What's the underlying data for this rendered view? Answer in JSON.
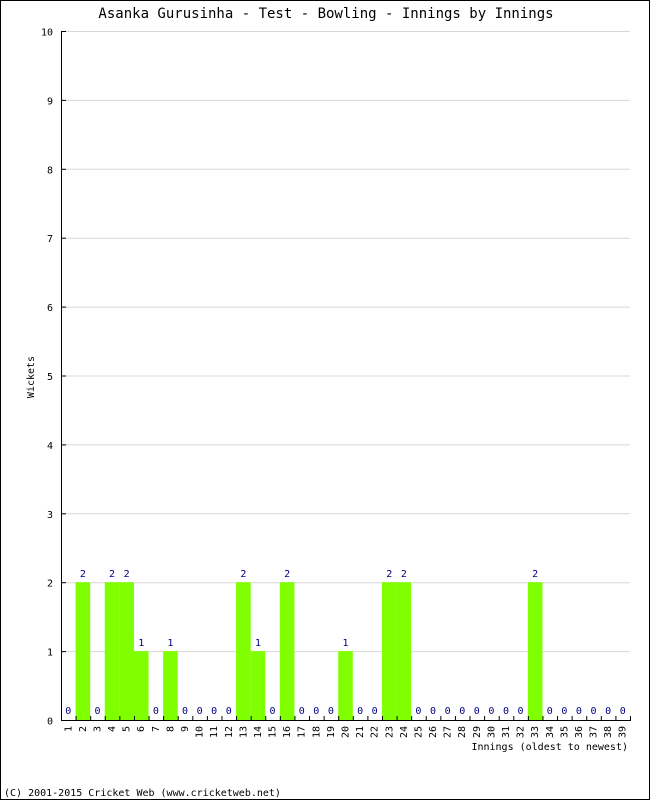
{
  "chart_data": {
    "type": "bar",
    "title": "Asanka Gurusinha - Test - Bowling - Innings by Innings",
    "xlabel": "Innings (oldest to newest)",
    "ylabel": "Wickets",
    "ylim": [
      0,
      10
    ],
    "yticks": [
      0,
      1,
      2,
      3,
      4,
      5,
      6,
      7,
      8,
      9,
      10
    ],
    "grid": true,
    "bar_color": "#80ff00",
    "label_color": "#000080",
    "categories": [
      "1",
      "2",
      "3",
      "4",
      "5",
      "6",
      "7",
      "8",
      "9",
      "10",
      "11",
      "12",
      "13",
      "14",
      "15",
      "16",
      "17",
      "18",
      "19",
      "20",
      "21",
      "22",
      "23",
      "24",
      "25",
      "26",
      "27",
      "28",
      "29",
      "30",
      "31",
      "32",
      "33",
      "34",
      "35",
      "36",
      "37",
      "38",
      "39"
    ],
    "values": [
      0,
      2,
      0,
      2,
      2,
      1,
      0,
      1,
      0,
      0,
      0,
      0,
      2,
      1,
      0,
      2,
      0,
      0,
      0,
      1,
      0,
      0,
      2,
      2,
      0,
      0,
      0,
      0,
      0,
      0,
      0,
      0,
      2,
      0,
      0,
      0,
      0,
      0,
      0
    ]
  },
  "footer": "(C) 2001-2015 Cricket Web (www.cricketweb.net)"
}
